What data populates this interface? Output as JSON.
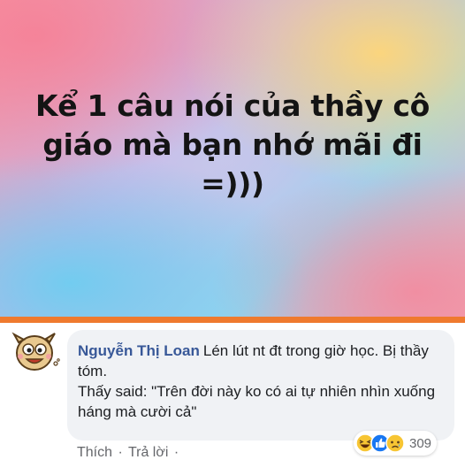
{
  "banner": {
    "headline_line1": "Kể 1 câu nói của thầy cô",
    "headline_line2": "giáo mà bạn nhớ mãi đi",
    "headline_line3": "=)))"
  },
  "comment": {
    "author": "Nguyễn Thị Loan",
    "text_part1": "Lén lút nt đt trong giờ học. Bị thầy tóm.",
    "text_part2": "Thấy said: \"Trên đời này ko có ai tự nhiên nhìn xuống háng mà cười cả\"",
    "actions": {
      "like": "Thích",
      "separator1": "·",
      "reply": "Trả lời",
      "separator2": "·"
    },
    "reactions": {
      "icons": [
        "haha-icon",
        "like-icon",
        "sad-icon"
      ],
      "count": "309"
    }
  },
  "colors": {
    "divider": "#ef7a2e",
    "author": "#385898",
    "bubble": "#f0f2f5"
  }
}
